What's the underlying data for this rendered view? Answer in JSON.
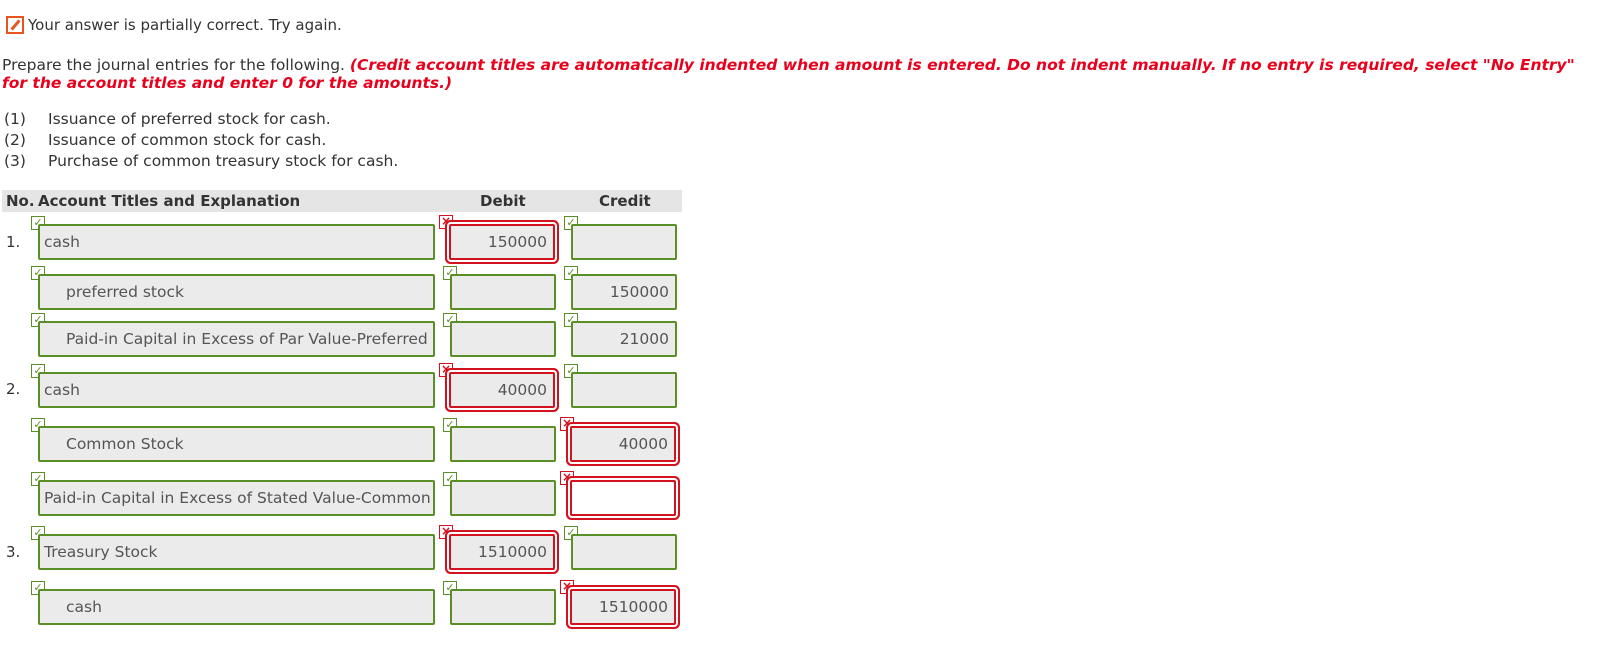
{
  "status": {
    "text": "Your answer is partially correct.  Try again."
  },
  "instructions": {
    "lead": "Prepare the journal entries for the following. ",
    "note": "(Credit account titles are automatically indented when amount is entered. Do not indent manually. If no entry is required, select \"No Entry\" for the account titles and enter 0 for the amounts.)"
  },
  "transactions": [
    {
      "num": "(1)",
      "text": "Issuance of preferred stock for cash."
    },
    {
      "num": "(2)",
      "text": "Issuance of common stock for cash."
    },
    {
      "num": "(3)",
      "text": "Purchase of common treasury stock for cash."
    }
  ],
  "table": {
    "headers": {
      "no": "No.",
      "account": "Account Titles and Explanation",
      "debit": "Debit",
      "credit": "Credit"
    },
    "entry_numbers": [
      "1.",
      "2.",
      "3."
    ],
    "rows": [
      {
        "account": "cash",
        "debit": "150000",
        "credit": ""
      },
      {
        "account": "preferred stock",
        "debit": "",
        "credit": "150000"
      },
      {
        "account": "Paid-in Capital in Excess of Par Value-Preferred Stock",
        "debit": "",
        "credit": "21000"
      },
      {
        "account": "cash",
        "debit": "40000",
        "credit": ""
      },
      {
        "account": "Common Stock",
        "debit": "",
        "credit": "40000"
      },
      {
        "account": "Paid-in Capital in Excess of Stated Value-Common Stock",
        "debit": "",
        "credit": ""
      },
      {
        "account": "Treasury Stock",
        "debit": "1510000",
        "credit": ""
      },
      {
        "account": "cash",
        "debit": "",
        "credit": "1510000"
      }
    ]
  },
  "colors": {
    "correct": "#5a8f28",
    "incorrect": "#d3121f",
    "instruction_red": "#e8001c",
    "status_icon": "#e8541e"
  },
  "icons": {
    "status": "pencil-icon",
    "correct": "check-icon",
    "incorrect": "x-icon"
  }
}
